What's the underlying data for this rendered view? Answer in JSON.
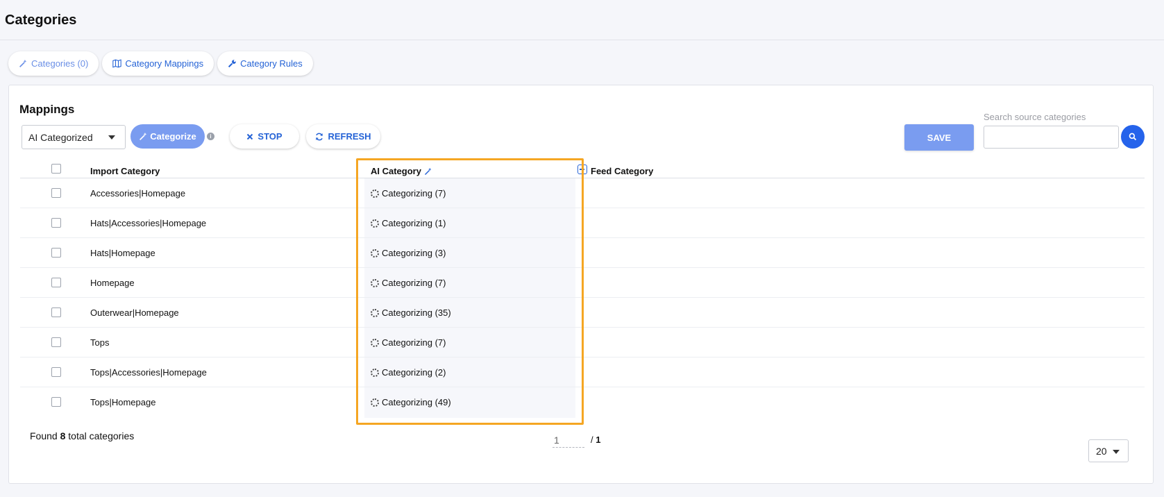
{
  "page": {
    "title": "Categories"
  },
  "tabs": [
    {
      "label": "Categories (0)",
      "icon": "wand-icon",
      "active": true
    },
    {
      "label": "Category Mappings",
      "icon": "map-icon",
      "active": false
    },
    {
      "label": "Category Rules",
      "icon": "wrench-icon",
      "active": false
    }
  ],
  "mappings": {
    "title": "Mappings",
    "filter_value": "AI Categorized",
    "categorize_label": "Categorize",
    "stop_label": "STOP",
    "refresh_label": "REFRESH",
    "save_label": "SAVE",
    "search_label": "Search source categories",
    "search_value": "",
    "columns": {
      "import": "Import Category",
      "ai": "AI Category",
      "feed": "Feed Category"
    },
    "rows": [
      {
        "import": "Accessories|Homepage",
        "ai": "Categorizing (7)"
      },
      {
        "import": "Hats|Accessories|Homepage",
        "ai": "Categorizing (1)"
      },
      {
        "import": "Hats|Homepage",
        "ai": "Categorizing (3)"
      },
      {
        "import": "Homepage",
        "ai": "Categorizing (7)"
      },
      {
        "import": "Outerwear|Homepage",
        "ai": "Categorizing (35)"
      },
      {
        "import": "Tops",
        "ai": "Categorizing (7)"
      },
      {
        "import": "Tops|Accessories|Homepage",
        "ai": "Categorizing (2)"
      },
      {
        "import": "Tops|Homepage",
        "ai": "Categorizing (49)"
      }
    ],
    "footer": {
      "found_prefix": "Found",
      "found_count": "8",
      "found_suffix": "total categories",
      "current_page": "1",
      "total_pages_prefix": "/",
      "total_pages": "1",
      "per_page": "20"
    }
  },
  "colors": {
    "accent": "#2563d6",
    "button_primary_disabled": "#7a9cf0",
    "highlight_frame": "#f5a623"
  }
}
